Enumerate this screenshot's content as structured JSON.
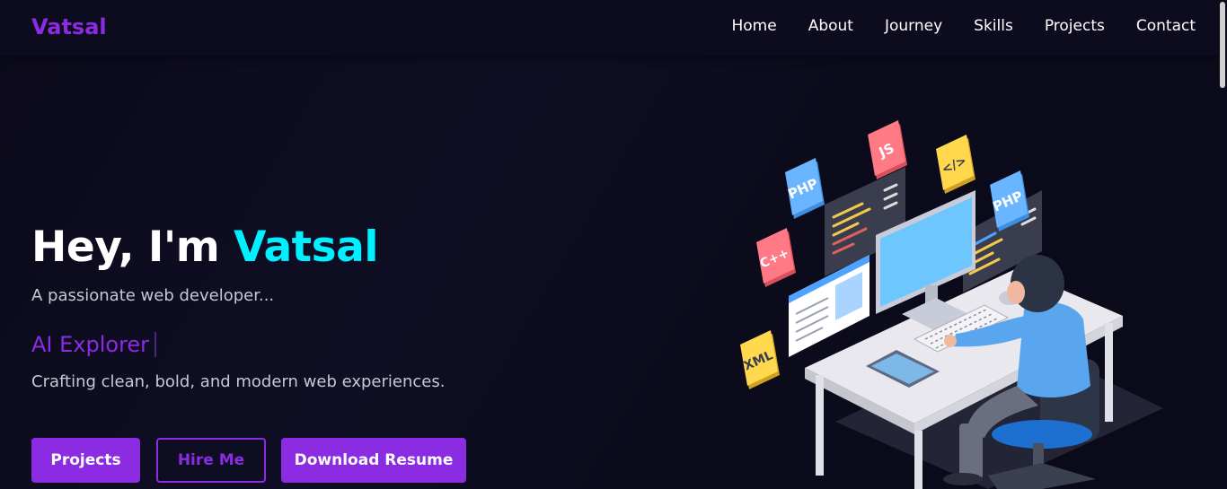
{
  "brand": {
    "logo_text": "Vatsal"
  },
  "nav": {
    "items": [
      "Home",
      "About",
      "Journey",
      "Skills",
      "Projects",
      "Contact"
    ]
  },
  "hero": {
    "greeting": "Hey, I'm ",
    "name": "Vatsal",
    "subtitle": "A passionate web developer...",
    "typed_text": "AI Explorer",
    "description": "Crafting clean, bold, and modern web experiences."
  },
  "buttons": {
    "projects": "Projects",
    "hire_me": "Hire Me",
    "download_resume": "Download Resume"
  },
  "illustration": {
    "badges": [
      "PHP",
      "JS",
      "</>",
      "PHP",
      "C++",
      "XML"
    ]
  },
  "colors": {
    "accent": "#8b2be2",
    "highlight": "#00f0ff",
    "background": "#0c0b1d"
  }
}
